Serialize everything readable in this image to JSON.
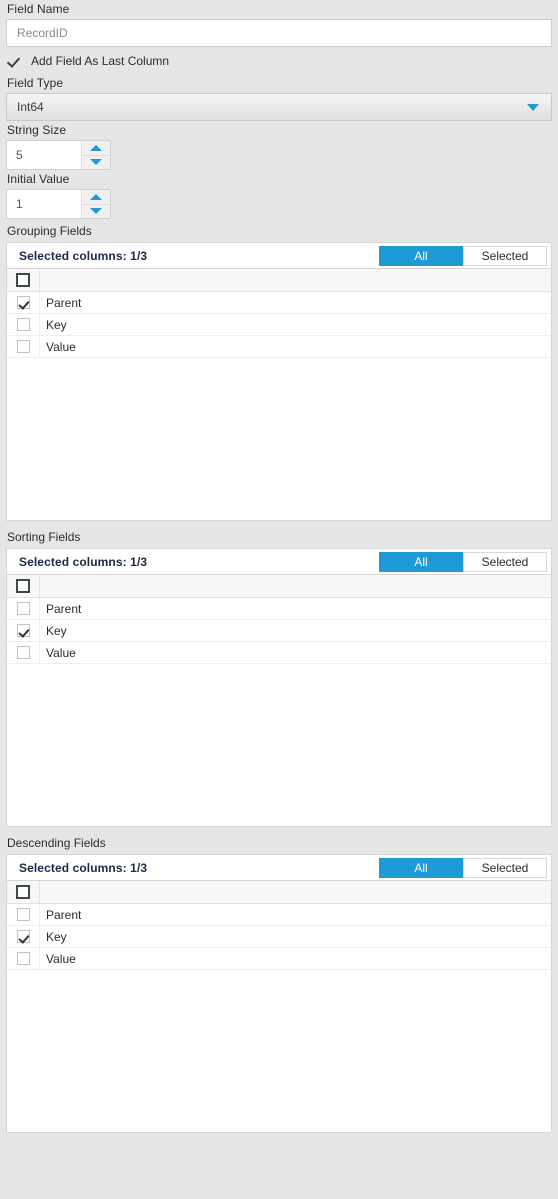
{
  "form": {
    "field_name_label": "Field Name",
    "field_name_value": "RecordID",
    "add_last_column_label": "Add Field As Last Column",
    "add_last_column_checked": true,
    "field_type_label": "Field Type",
    "field_type_value": "Int64",
    "string_size_label": "String Size",
    "string_size_value": "5",
    "initial_value_label": "Initial Value",
    "initial_value_value": "1"
  },
  "toggle": {
    "all_label": "All",
    "selected_label": "Selected"
  },
  "sections": [
    {
      "title": "Grouping Fields",
      "selected_summary": "Selected columns: 1/3",
      "active_toggle": "All",
      "header_checked": false,
      "rows": [
        {
          "label": "Parent",
          "checked": true
        },
        {
          "label": "Key",
          "checked": false
        },
        {
          "label": "Value",
          "checked": false
        }
      ]
    },
    {
      "title": "Sorting Fields",
      "selected_summary": "Selected columns: 1/3",
      "active_toggle": "All",
      "header_checked": false,
      "rows": [
        {
          "label": "Parent",
          "checked": false
        },
        {
          "label": "Key",
          "checked": true
        },
        {
          "label": "Value",
          "checked": false
        }
      ]
    },
    {
      "title": "Descending Fields",
      "selected_summary": "Selected columns: 1/3",
      "active_toggle": "All",
      "header_checked": false,
      "rows": [
        {
          "label": "Parent",
          "checked": false
        },
        {
          "label": "Key",
          "checked": true
        },
        {
          "label": "Value",
          "checked": false
        }
      ]
    }
  ],
  "colors": {
    "accent": "#1e9ad6",
    "page_background": "#e6e6e6",
    "panel": "#ffffff",
    "summary_text": "#1b2a4a"
  }
}
